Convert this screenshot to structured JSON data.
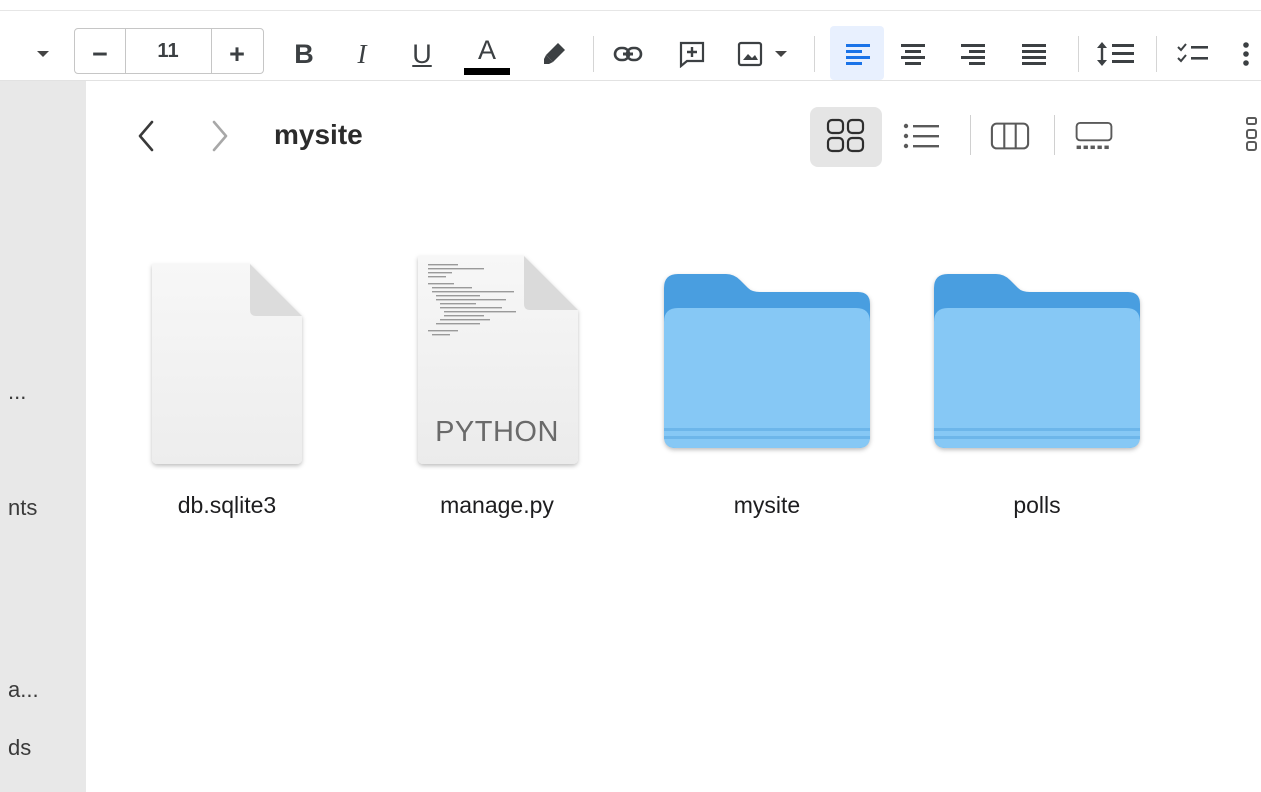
{
  "toolbar": {
    "font_size": "11",
    "minus_label": "−",
    "plus_label": "+",
    "bold_label": "B",
    "italic_label": "I",
    "underline_label": "U",
    "text_color_label": "A",
    "text_color_swatch": "#000000",
    "active_accent": "#1a73e8"
  },
  "finder": {
    "title": "mysite",
    "items": [
      {
        "name": "db.sqlite3",
        "kind": "document-blank"
      },
      {
        "name": "manage.py",
        "kind": "document-python",
        "badge": "PYTHON"
      },
      {
        "name": "mysite",
        "kind": "folder"
      },
      {
        "name": "polls",
        "kind": "folder"
      }
    ],
    "folder_color": "#79c2f4"
  },
  "sidebar": {
    "items": [
      "...",
      "nts",
      "a...",
      "ds"
    ]
  }
}
